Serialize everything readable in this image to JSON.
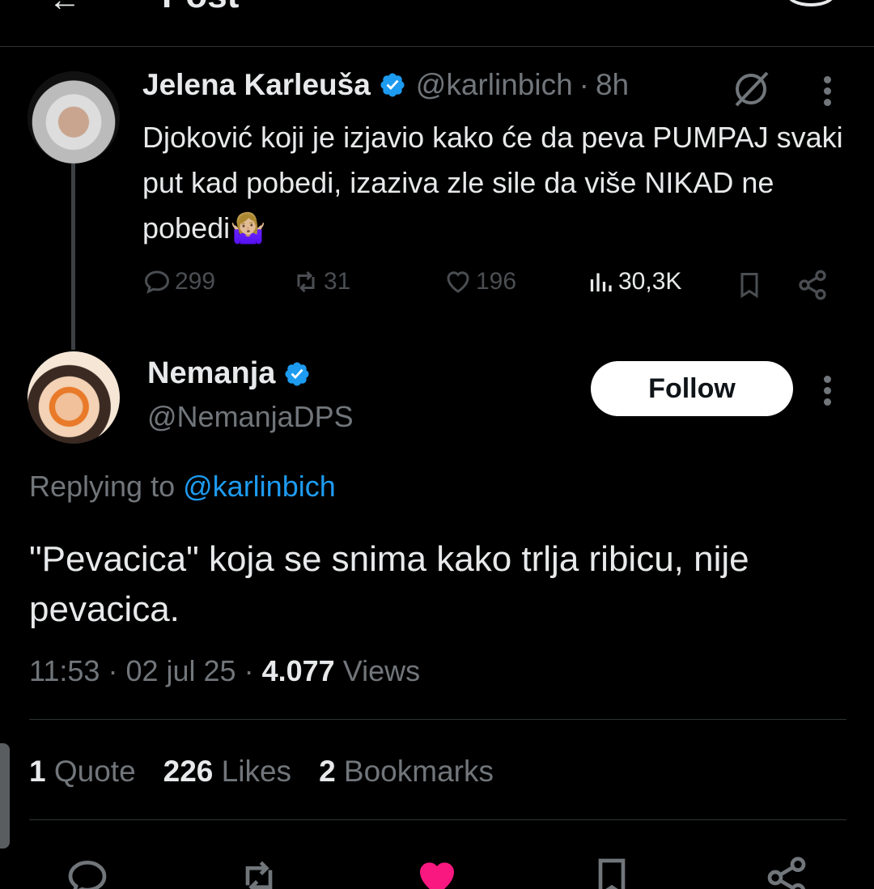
{
  "header": {
    "title": "Post"
  },
  "parent_tweet": {
    "author_name": "Jelena Karleuša",
    "handle": "@karlinbich",
    "separator": "·",
    "time": "8h",
    "text": "Djoković koji je izjavio kako će da peva PUMPAJ svaki put kad pobedi, izaziva zle sile da više NIKAD ne pobedi🤷🏼‍♀️",
    "replies": "299",
    "reposts": "31",
    "likes": "196",
    "views": "30,3K"
  },
  "reply_tweet": {
    "author_name": "Nemanja",
    "handle": "@NemanjaDPS",
    "follow_label": "Follow",
    "replying_prefix": "Replying to",
    "replying_to": "@karlinbich",
    "text": "\"Pevacica\" koja se snima kako trlja ribicu, nije pevacica.",
    "time": "11:53",
    "sep1": "·",
    "date": "02 jul 25",
    "sep2": "·",
    "views_count": "4.077",
    "views_label": "Views"
  },
  "stats": {
    "quotes_count": "1",
    "quotes_label": "Quote",
    "likes_count": "226",
    "likes_label": "Likes",
    "bookmarks_count": "2",
    "bookmarks_label": "Bookmarks"
  },
  "colors": {
    "background": "#000000",
    "text": "#e7e9ea",
    "muted": "#71767b",
    "link": "#1d9bf0",
    "verified": "#1d9bf0",
    "like_active": "#f91880"
  }
}
